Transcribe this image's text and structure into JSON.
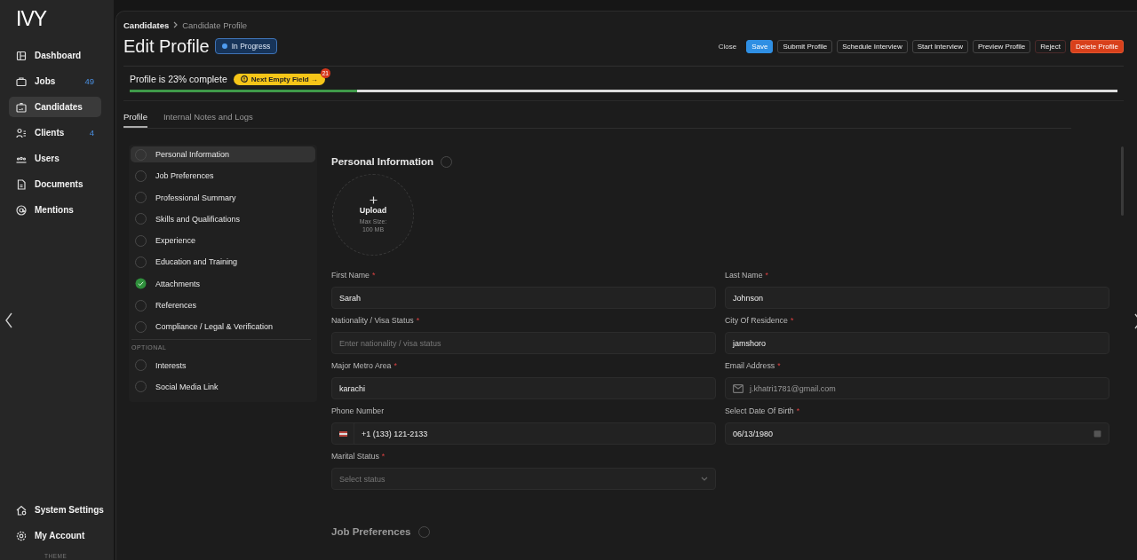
{
  "sidebar": {
    "logo": "IVY",
    "nav": [
      {
        "label": "Dashboard",
        "selected": false
      },
      {
        "label": "Jobs",
        "selected": false,
        "count": "49"
      },
      {
        "label": "Candidates",
        "selected": true
      },
      {
        "label": "Clients",
        "selected": false,
        "count": "4"
      },
      {
        "label": "Users",
        "selected": false
      },
      {
        "label": "Documents",
        "selected": false
      },
      {
        "label": "Mentions",
        "selected": false
      }
    ],
    "footer": [
      {
        "label": "System Settings"
      },
      {
        "label": "My Account"
      }
    ],
    "theme_label": "THEME"
  },
  "breadcrumb": [
    "Candidates",
    "Candidate Profile"
  ],
  "page": {
    "title": "Edit Profile",
    "status": "In Progress"
  },
  "actions": [
    {
      "label": "Close",
      "kind": "plain"
    },
    {
      "label": "Save",
      "kind": "primary"
    },
    {
      "label": "Submit Profile",
      "kind": "outline"
    },
    {
      "label": "Schedule Interview",
      "kind": "outline"
    },
    {
      "label": "Start Interview",
      "kind": "outline"
    },
    {
      "label": "Preview Profile",
      "kind": "outline"
    },
    {
      "label": "Reject",
      "kind": "reject"
    },
    {
      "label": "Delete Profile",
      "kind": "danger"
    }
  ],
  "progress": {
    "text": "Profile is 23% complete",
    "next_button": "Next Empty Field →",
    "badge": "21",
    "level": 0.23
  },
  "tabs": [
    {
      "label": "Profile",
      "selected": true
    },
    {
      "label": "Internal Notes and Logs",
      "selected": false
    }
  ],
  "sections": {
    "items": [
      {
        "label": "Personal Information",
        "selected": true,
        "completed": false
      },
      {
        "label": "Job Preferences",
        "selected": false,
        "completed": false
      },
      {
        "label": "Professional Summary",
        "selected": false,
        "completed": false
      },
      {
        "label": "Skills and Qualifications",
        "selected": false,
        "completed": false
      },
      {
        "label": "Experience",
        "selected": false,
        "completed": false
      },
      {
        "label": "Education and Training",
        "selected": false,
        "completed": false
      },
      {
        "label": "Attachments",
        "selected": false,
        "completed": true
      },
      {
        "label": "References",
        "selected": false,
        "completed": false
      },
      {
        "label": "Compliance / Legal & Verification",
        "selected": false,
        "completed": false
      }
    ],
    "optional_heading": "OPTIONAL",
    "optional_items": [
      {
        "label": "Interests",
        "selected": false,
        "completed": false
      },
      {
        "label": "Social Media Link",
        "selected": false,
        "completed": false
      }
    ]
  },
  "form": {
    "heading": "Personal Information",
    "completed": false,
    "upload": {
      "label": "Upload",
      "hint": "Max Size:",
      "hint_size": "100 MB"
    },
    "fields": [
      {
        "kind": "text",
        "label": "First Name",
        "required_mark": "*",
        "value": "Sarah"
      },
      {
        "kind": "text",
        "label": "Last Name",
        "required_mark": "*",
        "value": "Johnson"
      },
      {
        "kind": "text",
        "label": "Nationality / Visa Status",
        "required_mark": "*",
        "placeholder": "Enter nationality / visa status"
      },
      {
        "kind": "text",
        "label": "City Of Residence",
        "required_mark": "*",
        "value": "jamshoro"
      },
      {
        "kind": "text",
        "label": "Major Metro Area",
        "required_mark": "*",
        "value": "karachi"
      },
      {
        "kind": "email",
        "label": "Email Address",
        "required_mark": "*",
        "value": "j.khatri1781@gmail.com"
      },
      {
        "kind": "phone",
        "label": "Phone Number",
        "value": "+1 (133) 121-2133"
      },
      {
        "kind": "date",
        "label": "Select Date Of Birth",
        "required_mark": "*",
        "value": "06/13/1980"
      },
      {
        "kind": "select",
        "label": "Marital Status",
        "required_mark": "*",
        "placeholder": "Select status"
      }
    ],
    "next_heading": "Job Preferences",
    "next_completed": false
  }
}
